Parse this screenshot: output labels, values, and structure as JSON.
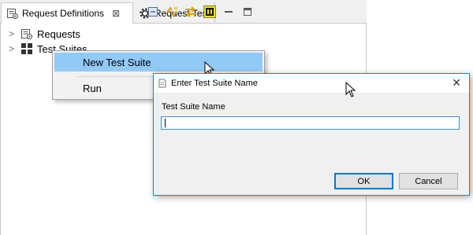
{
  "tabs": [
    {
      "label": "Request Definitions",
      "icon": "request-definitions-icon",
      "active": true,
      "close_glyph": "⊠"
    },
    {
      "label": "Request Test",
      "icon": "gear-icon",
      "active": false
    }
  ],
  "toolbar": {
    "icons": [
      "collapse-all-icon",
      "sync-icon",
      "link-with-editor-icon",
      "tt-icon",
      "minimize-icon",
      "maximize-icon"
    ]
  },
  "tree": {
    "items": [
      {
        "label": "Requests",
        "icon": "requests-icon",
        "twisty": ">"
      },
      {
        "label": "Test Suites",
        "icon": "test-suites-icon",
        "twisty": ">"
      }
    ]
  },
  "context_menu": {
    "items": [
      {
        "label": "New Test Suite",
        "hovered": true
      },
      {
        "label": "Run",
        "hovered": false
      }
    ]
  },
  "dialog": {
    "title": "Enter Test Suite Name",
    "close_glyph": "✕",
    "field_label": "Test Suite Name",
    "field_value": "",
    "ok_label": "OK",
    "cancel_label": "Cancel"
  },
  "colors": {
    "menu_highlight": "#91c9f7",
    "dialog_border": "#1883d7",
    "focus_border": "#3a8fd8"
  }
}
